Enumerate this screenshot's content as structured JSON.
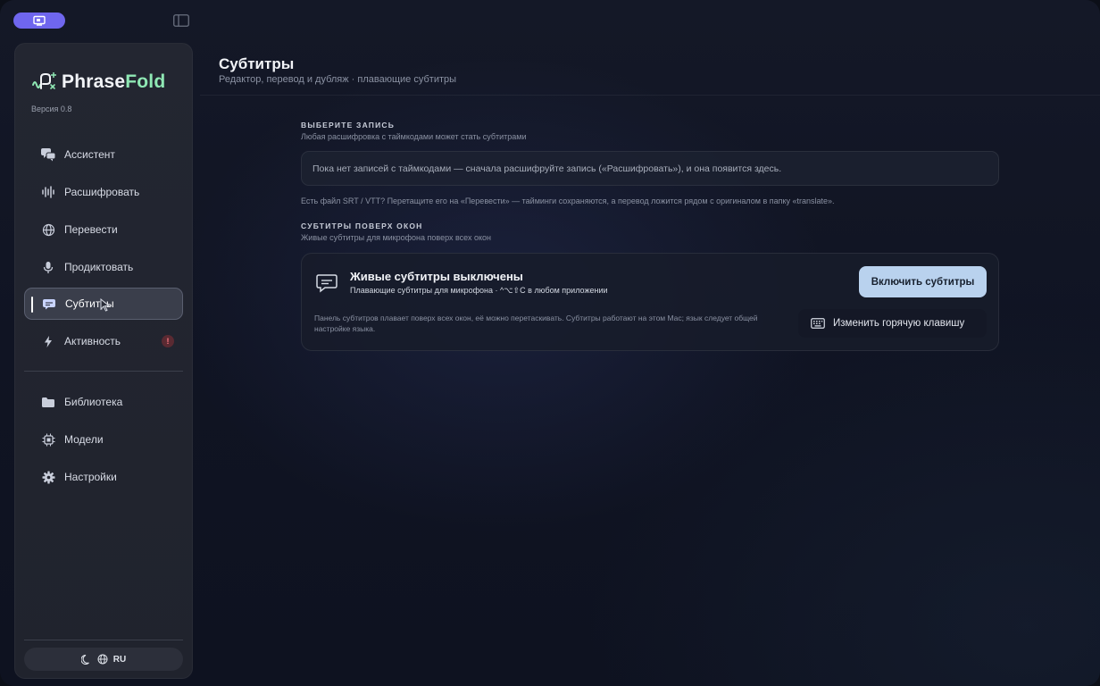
{
  "app": {
    "name_main": "Phrase",
    "name_accent": "Fold",
    "version": "Версия 0.8"
  },
  "sidebar": {
    "items": [
      {
        "label": "Ассистент",
        "icon": "chat-bubbles-icon"
      },
      {
        "label": "Расшифровать",
        "icon": "waveform-icon"
      },
      {
        "label": "Перевести",
        "icon": "globe-icon"
      },
      {
        "label": "Продиктовать",
        "icon": "microphone-icon"
      },
      {
        "label": "Субтитры",
        "icon": "subtitles-icon",
        "active": true
      },
      {
        "label": "Активность",
        "icon": "lightning-icon",
        "badge": "!"
      },
      {
        "label": "Библиотека",
        "icon": "folder-icon"
      },
      {
        "label": "Модели",
        "icon": "chip-icon"
      },
      {
        "label": "Настройки",
        "icon": "gear-icon"
      }
    ],
    "footer": {
      "language": "RU",
      "theme_icon": "moon-icon",
      "lang_icon": "globe-icon"
    }
  },
  "header": {
    "title": "Субтитры",
    "subtitle": "Редактор, перевод и дубляж · плавающие субтитры"
  },
  "select_record": {
    "label": "ВЫБЕРИТЕ ЗАПИСЬ",
    "hint": "Любая расшифровка с таймкодами может стать субтитрами",
    "empty_text": "Пока нет записей с таймкодами — сначала расшифруйте запись («Расшифровать»), и она появится здесь.",
    "file_hint": "Есть файл SRT / VTT? Перетащите его на «Перевести» — тайминги сохраняются, а перевод ложится рядом с оригиналом в папку «translate»."
  },
  "overlay": {
    "label": "СУБТИТРЫ ПОВЕРХ ОКОН",
    "hint": "Живые субтитры для микрофона поверх всех окон",
    "card_title": "Живые субтитры выключены",
    "card_subtitle": "Плавающие субтитры для микрофона · ^⌥⇧C в любом приложении",
    "card_description": "Панель субтитров плавает поверх всех окон, её можно перетаскивать. Субтитры работают на этом Mac; язык следует общей настройке языка.",
    "enable_label": "Включить субтитры",
    "hotkey_label": "Изменить горячую клавишу"
  },
  "colors": {
    "accent": "#6f66ee",
    "brand_accent": "#8fe8b4",
    "primary_button": "#b9d2ee",
    "badge": "#ff7a84"
  }
}
